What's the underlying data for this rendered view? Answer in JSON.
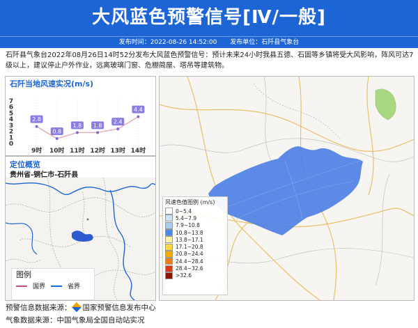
{
  "header": {
    "title": "大风蓝色预警信号[Ⅳ/一般]",
    "publish_time": "发布时间：2022-08-26 14:52:00",
    "publisher": "发布单位：石阡县气象台"
  },
  "description": "石阡县气象台2022年08月26日14时52分发布大风蓝色预警信号：预计未来24小时我县五德、石固等乡镇将受大风影响，阵风可达7级以上，建议停止户外作业，远离玻璃门窗、危棚简屋、塔吊等建筑物。",
  "wind_panel": {
    "title": "石阡当地风速实况(m/s)",
    "chart_data": {
      "type": "line",
      "categories": [
        "9时",
        "10时",
        "11时",
        "12时",
        "13时",
        "14时"
      ],
      "values": [
        2.8,
        0.8,
        1.8,
        1.8,
        2.4,
        4.4
      ],
      "ylim": [
        0,
        7
      ],
      "yticks": [
        "0",
        "1",
        "2",
        "3",
        "4",
        "5",
        "6",
        "7"
      ]
    }
  },
  "location_panel": {
    "title": "定位概览",
    "region": "贵州省-铜仁市-石阡县",
    "legend_title": "图例",
    "legend_items": [
      {
        "label": "国界",
        "color": "#c0506e"
      },
      {
        "label": "省界",
        "color": "#1d64d4"
      }
    ]
  },
  "map_legend": {
    "title": "风速色值图例 (m/s)",
    "items": [
      {
        "label": "0~5.4",
        "color": "#ffffff"
      },
      {
        "label": "5.4~7.9",
        "color": "#cfe3f6"
      },
      {
        "label": "7.9~10.8",
        "color": "#a9cdef"
      },
      {
        "label": "10.8~13.8",
        "color": "#4f8ae8"
      },
      {
        "label": "13.8~17.1",
        "color": "#fff3a8"
      },
      {
        "label": "17.1~20.8",
        "color": "#ffd84a"
      },
      {
        "label": "20.8~24.4",
        "color": "#f6a800"
      },
      {
        "label": "24.4~28.4",
        "color": "#f07d14"
      },
      {
        "label": "28.4~32.6",
        "color": "#d83a1a"
      },
      {
        "label": ">32.6",
        "color": "#8e1408"
      }
    ]
  },
  "footer": {
    "warning_source_label": "预警信息数据来源：",
    "warning_source": "国家预警信息发布中心",
    "weather_source": "气象数据来源：中国气象局全国自动站实况"
  },
  "colors": {
    "brand": "#1d64d4",
    "warning_area": "#4f7fe6"
  }
}
